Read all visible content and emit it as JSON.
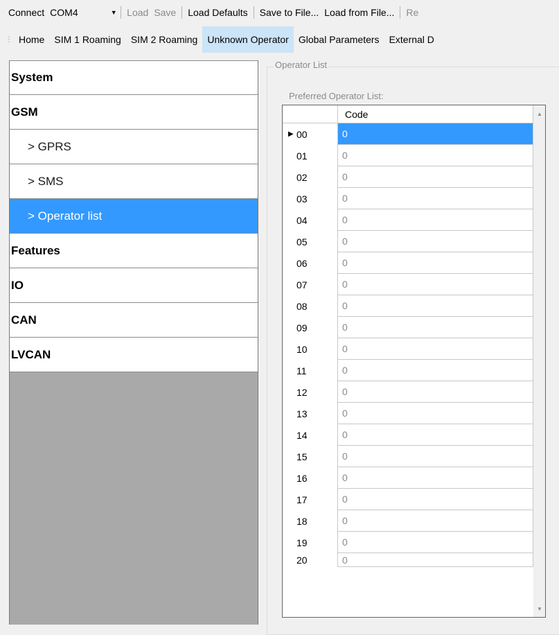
{
  "toolbar": {
    "connect_label": "Connect",
    "port_value": "COM4",
    "load_label": "Load",
    "save_label": "Save",
    "load_defaults_label": "Load Defaults",
    "save_to_file_label": "Save to File...",
    "load_from_file_label": "Load from File...",
    "re_label": "Re"
  },
  "tabs": [
    {
      "label": "Home"
    },
    {
      "label": "SIM 1 Roaming"
    },
    {
      "label": "SIM 2 Roaming"
    },
    {
      "label": "Unknown Operator"
    },
    {
      "label": "Global Parameters"
    },
    {
      "label": "External D"
    }
  ],
  "active_tab": "Unknown Operator",
  "nav": {
    "items": [
      {
        "label": "System"
      },
      {
        "label": "GSM"
      },
      {
        "label": "> GPRS"
      },
      {
        "label": "> SMS"
      },
      {
        "label": "> Operator list"
      },
      {
        "label": "Features"
      },
      {
        "label": "IO"
      },
      {
        "label": "CAN"
      },
      {
        "label": "LVCAN"
      }
    ],
    "selected": "> Operator list"
  },
  "operator_panel": {
    "group_title": "Operator List",
    "list_label": "Preferred Operator List:",
    "column_header": "Code",
    "rows": [
      {
        "index": "00",
        "code": "0"
      },
      {
        "index": "01",
        "code": "0"
      },
      {
        "index": "02",
        "code": "0"
      },
      {
        "index": "03",
        "code": "0"
      },
      {
        "index": "04",
        "code": "0"
      },
      {
        "index": "05",
        "code": "0"
      },
      {
        "index": "06",
        "code": "0"
      },
      {
        "index": "07",
        "code": "0"
      },
      {
        "index": "08",
        "code": "0"
      },
      {
        "index": "09",
        "code": "0"
      },
      {
        "index": "10",
        "code": "0"
      },
      {
        "index": "11",
        "code": "0"
      },
      {
        "index": "12",
        "code": "0"
      },
      {
        "index": "13",
        "code": "0"
      },
      {
        "index": "14",
        "code": "0"
      },
      {
        "index": "15",
        "code": "0"
      },
      {
        "index": "16",
        "code": "0"
      },
      {
        "index": "17",
        "code": "0"
      },
      {
        "index": "18",
        "code": "0"
      },
      {
        "index": "19",
        "code": "0"
      },
      {
        "index": "20",
        "code": "0"
      }
    ]
  },
  "icons": {
    "combo_arrow": "dropdown-arrow-icon",
    "row_marker": "current-row-marker-icon",
    "scroll_up": "scroll-up-icon",
    "scroll_down": "scroll-down-icon"
  },
  "colors": {
    "selection": "#3399ff",
    "active_tab": "#cce4f7",
    "disabled_text": "#8a8a8a"
  }
}
